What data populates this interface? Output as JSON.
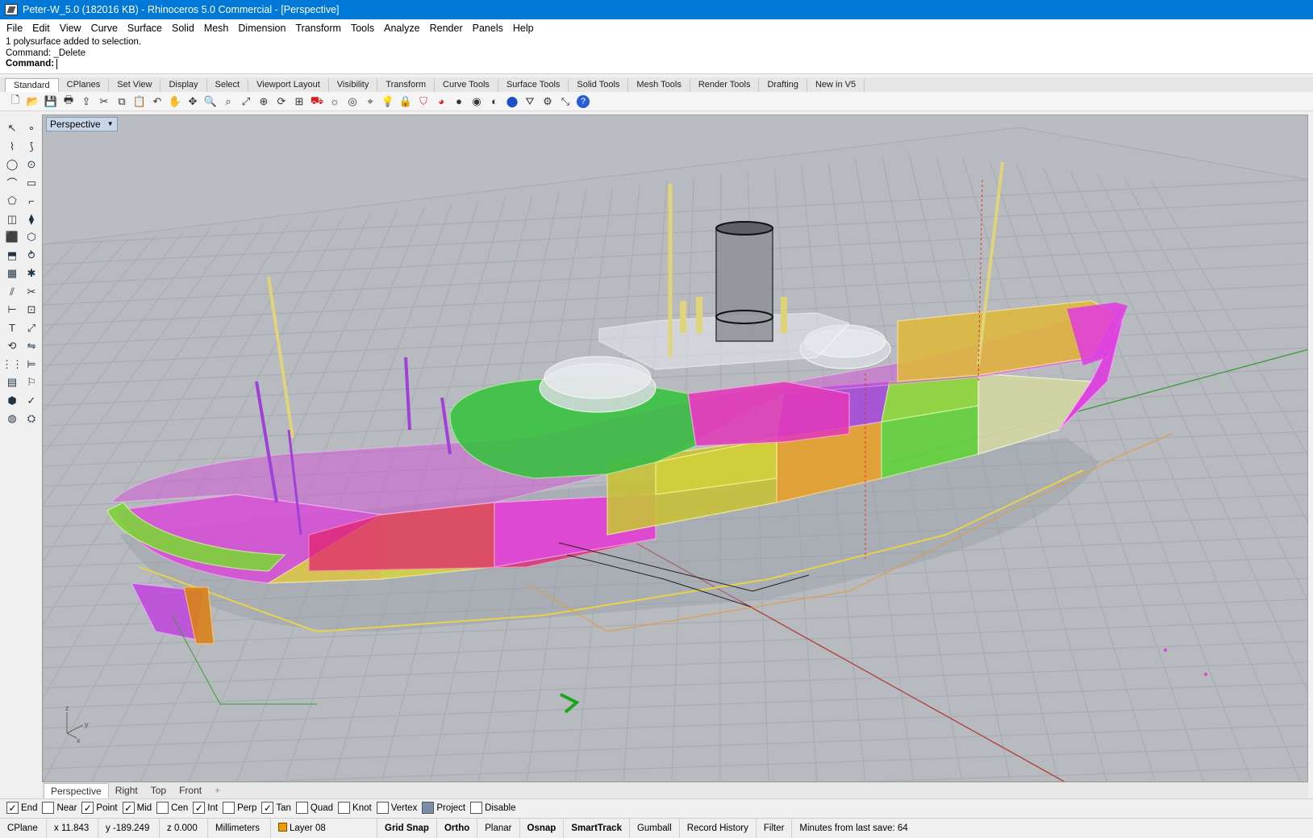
{
  "window": {
    "title": "Peter-W_5.0 (182016 KB) - Rhinoceros 5.0 Commercial - [Perspective]"
  },
  "menu": [
    "File",
    "Edit",
    "View",
    "Curve",
    "Surface",
    "Solid",
    "Mesh",
    "Dimension",
    "Transform",
    "Tools",
    "Analyze",
    "Render",
    "Panels",
    "Help"
  ],
  "command": {
    "history": [
      "1 polysurface added to selection.",
      "Command: _Delete"
    ],
    "prompt_label": "Command:",
    "value": ""
  },
  "toolbar_tabs": [
    "Standard",
    "CPlanes",
    "Set View",
    "Display",
    "Select",
    "Viewport Layout",
    "Visibility",
    "Transform",
    "Curve Tools",
    "Surface Tools",
    "Solid Tools",
    "Mesh Tools",
    "Render Tools",
    "Drafting",
    "New in V5"
  ],
  "standard_tools": [
    "new-icon",
    "open-icon",
    "save-icon",
    "print-icon",
    "import-icon",
    "cut-icon",
    "copy-icon",
    "paste-icon",
    "undo-icon",
    "pan-icon",
    "move-icon",
    "zoom-icon",
    "zoom-window-icon",
    "zoom-extents-icon",
    "zoom-selected-icon",
    "rotate-view-icon",
    "four-viewports-icon",
    "car-icon",
    "light-icon",
    "circle-grid-icon",
    "snap-icon",
    "lightbulb-icon",
    "lock-icon",
    "shield-icon",
    "color-wheel-icon",
    "shaded-sphere-icon",
    "rendered-sphere-icon",
    "ghosted-sphere-icon",
    "blue-sphere-icon",
    "filter-icon",
    "gear-icon",
    "transform-icon",
    "help-icon"
  ],
  "left_tools": [
    "select-icon",
    "point-icon",
    "polyline-icon",
    "curve-icon",
    "circle-icon",
    "ellipse-icon",
    "arc-icon",
    "rectangle-icon",
    "polygon-icon",
    "fillet-icon",
    "surface-icon",
    "loft-icon",
    "box-icon",
    "boolean-icon",
    "extrude-icon",
    "sweep-icon",
    "mesh-icon",
    "explode-icon",
    "split-icon",
    "trim-icon",
    "dim-icon",
    "group-icon",
    "text-icon",
    "scale-icon",
    "rotate-icon",
    "mirror-icon",
    "array-icon",
    "align-icon",
    "grid-icon",
    "analyze-icon",
    "solid-tools-icon",
    "check-icon",
    "render-icon",
    "material-icon"
  ],
  "viewport": {
    "active_label": "Perspective",
    "tabs": [
      "Perspective",
      "Right",
      "Top",
      "Front"
    ],
    "add_tab": "+",
    "axis": {
      "z": "z",
      "y": "y",
      "x": "x"
    }
  },
  "osnaps": [
    {
      "label": "End",
      "checked": true
    },
    {
      "label": "Near",
      "checked": false
    },
    {
      "label": "Point",
      "checked": true
    },
    {
      "label": "Mid",
      "checked": true
    },
    {
      "label": "Cen",
      "checked": false
    },
    {
      "label": "Int",
      "checked": true
    },
    {
      "label": "Perp",
      "checked": false
    },
    {
      "label": "Tan",
      "checked": true
    },
    {
      "label": "Quad",
      "checked": false
    },
    {
      "label": "Knot",
      "checked": false
    },
    {
      "label": "Vertex",
      "checked": false
    },
    {
      "label": "Project",
      "checked": false
    },
    {
      "label": "Disable",
      "checked": false
    }
  ],
  "status": {
    "cplane": "CPlane",
    "x": "x 11.843",
    "y": "y -189.249",
    "z": "z 0.000",
    "units": "Millimeters",
    "layer": "Layer 08",
    "grid_snap": "Grid Snap",
    "ortho": "Ortho",
    "planar": "Planar",
    "osnap": "Osnap",
    "smarttrack": "SmartTrack",
    "gumball": "Gumball",
    "record_history": "Record History",
    "filter": "Filter",
    "save_msg": "Minutes from last save: 64"
  },
  "colors": {
    "titlebar": "#0078d7",
    "viewport_bg": "#b9bcc1",
    "grid": "#a9acb2",
    "layer_swatch": "#f29b00"
  }
}
